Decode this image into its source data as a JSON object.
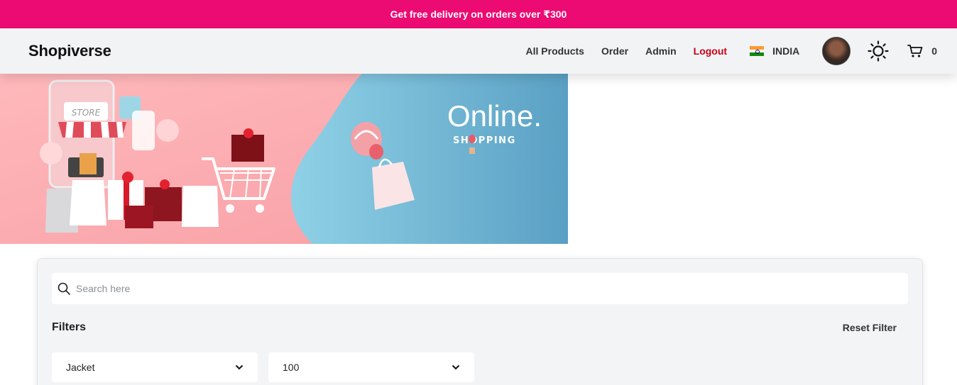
{
  "promo": {
    "text": "Get free delivery on orders over ₹300"
  },
  "header": {
    "brand": "Shopiverse",
    "nav": {
      "all_products": "All Products",
      "order": "Order",
      "admin": "Admin",
      "logout": "Logout"
    },
    "country": "INDIA",
    "cart_count": "0"
  },
  "banner": {
    "store_label": "STORE",
    "headline": "Online.",
    "subline": "SHOPPING"
  },
  "search": {
    "placeholder": "Search here",
    "value": ""
  },
  "filters": {
    "title": "Filters",
    "reset_label": "Reset Filter",
    "category_selected": "Jacket",
    "price_selected": "100"
  },
  "colors": {
    "promo": "#ec0b73",
    "logout": "#c40018",
    "nav_bg": "#f2f3f5"
  }
}
